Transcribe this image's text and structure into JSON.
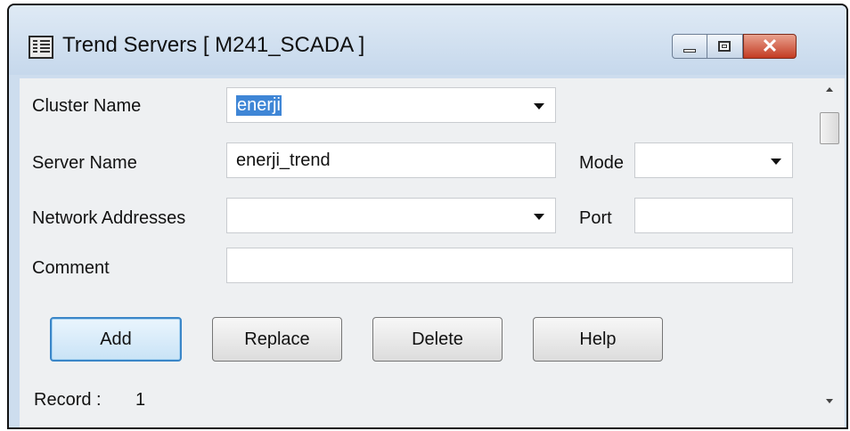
{
  "window": {
    "title": "Trend Servers [ M241_SCADA ]",
    "icons": {
      "app": "window-app-icon",
      "minimize": "minimize-icon",
      "maximize": "maximize-icon",
      "close": "close-icon"
    },
    "close_glyph": "✕"
  },
  "form": {
    "cluster_name": {
      "label": "Cluster Name",
      "value": "enerji"
    },
    "server_name": {
      "label": "Server Name",
      "value": "enerji_trend"
    },
    "mode": {
      "label": "Mode",
      "value": ""
    },
    "network_addresses": {
      "label": "Network Addresses",
      "value": ""
    },
    "port": {
      "label": "Port",
      "value": ""
    },
    "comment": {
      "label": "Comment",
      "value": ""
    }
  },
  "buttons": {
    "add": "Add",
    "replace": "Replace",
    "delete": "Delete",
    "help": "Help"
  },
  "record": {
    "label": "Record :",
    "value": "1"
  },
  "colors": {
    "selection": "#3f86d6",
    "close_button": "#c33b22",
    "default_button_border": "#3a86c8",
    "title_bar": "#cdddee"
  }
}
